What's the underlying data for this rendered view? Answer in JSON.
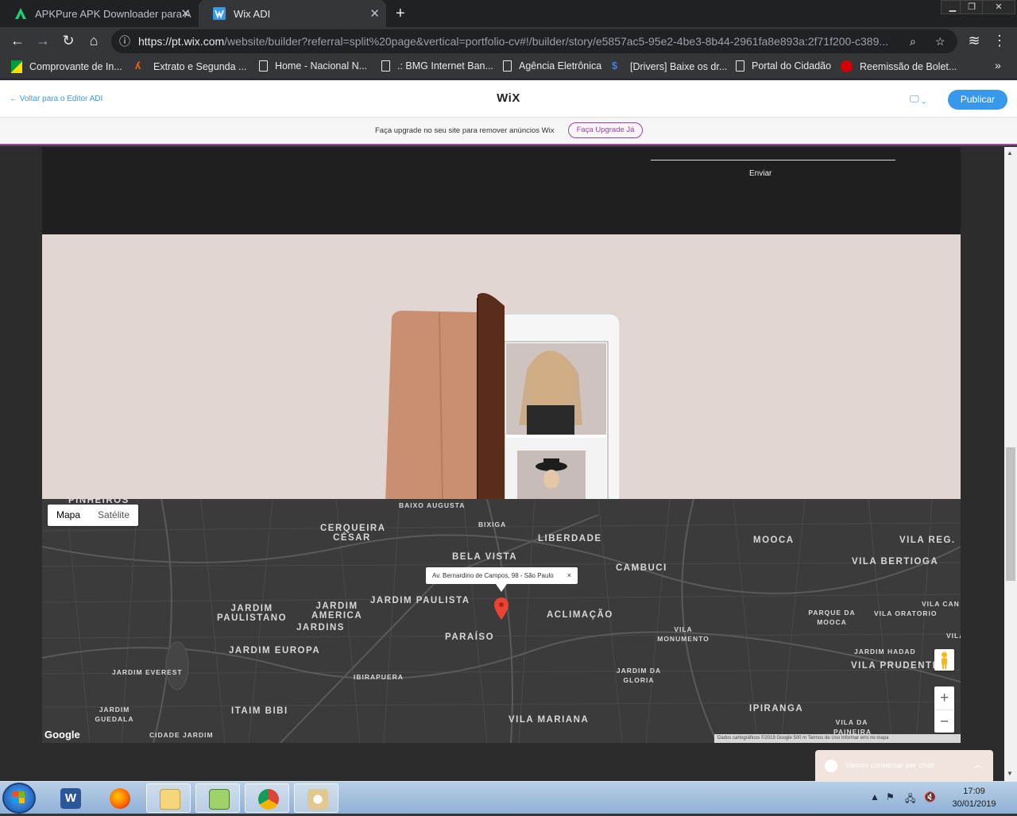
{
  "browser": {
    "tabs": [
      {
        "label": "APKPure APK Downloader para A",
        "favicon": "apkpure-icon"
      },
      {
        "label": "Wix ADI",
        "favicon": "wix-icon"
      }
    ],
    "new_tab": "+",
    "url_host": "https://pt.wix.com",
    "url_path": "/website/builder?referral=split%20page&vertical=portfolio-cv#!/builder/story/e5857ac5-95e2-4be3-8b44-2961fa8e893a:2f71f200-c389...",
    "bookmarks": [
      "Comprovante de In...",
      "Extrato e Segunda ...",
      "Home - Nacional N...",
      ".: BMG Internet Ban...",
      "Agência Eletrônica",
      "[Drivers] Baixe os dr...",
      "Portal do Cidadão",
      "Reemissão de Bolet..."
    ],
    "more_bookmarks": "»"
  },
  "wix": {
    "back_link": "← Voltar para o Editor ADI",
    "logo": "WiX",
    "publish_label": "Publicar",
    "upgrade_text": "Faça upgrade no seu site para remover anúncios Wix",
    "upgrade_button": "Faça Upgrade Já"
  },
  "site": {
    "send_label": "Enviar",
    "map": {
      "toggle_map": "Mapa",
      "toggle_satellite": "Satélite",
      "info_address": "Av. Bernardino de Campos, 98 - São Paulo",
      "info_close": "×",
      "zoom_in": "+",
      "zoom_out": "−",
      "google_logo": "Google",
      "footer": "Dados cartográficos ©2019 Google   500 m   Termos de Uso   Informar erro no mapa",
      "neighborhoods": [
        "PINHEIROS",
        "CERQUEIRA CÉSAR",
        "BAIXO AUGUSTA",
        "BIXIGA",
        "BELA VISTA",
        "LIBERDADE",
        "MOOCA",
        "VILA REG.",
        "VILA BERTIOGA",
        "CAMBUCI",
        "JARDIM PAULISTA",
        "JARDIM PAULISTANO",
        "JARDIM AMERICA",
        "JARDINS",
        "ACLIMAÇÃO",
        "PARAÍSO",
        "JARDIM EUROPA",
        "IBIRAPUERA",
        "JARDIM EVEREST",
        "ITAIM BIBI",
        "VILA MARIANA",
        "IPIRANGA",
        "VILA PRUDENTE",
        "PARQUE DA MOOCA",
        "VILA ORATORIO",
        "VILA MONUMENTO",
        "JARDIM DA GLORIA",
        "JARDIM HADAD",
        "JARDIM GUEDALA",
        "CIDADE JARDIM",
        "VILA CAN",
        "VILA",
        "VILA DA PAINEIRA"
      ]
    },
    "chat_label": "Vamos conversar por chat!"
  },
  "taskbar": {
    "time": "17:09",
    "date": "30/01/2019"
  }
}
